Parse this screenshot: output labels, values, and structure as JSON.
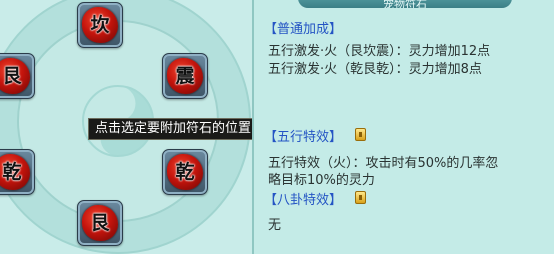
{
  "board": {
    "slots": [
      {
        "label": "坎"
      },
      {
        "label": "艮"
      },
      {
        "label": "震"
      },
      {
        "label": "乾"
      },
      {
        "label": "乾"
      },
      {
        "label": "艮"
      }
    ],
    "tooltip": "点击选定要附加符石的位置"
  },
  "panel": {
    "title": "宠物符石",
    "common_bonus": {
      "header": "【普通加成】",
      "lines": [
        "五行激发·火（艮坎震）：灵力增加12点",
        "五行激发·火（乾艮乾）：灵力增加8点"
      ]
    },
    "wuxing_effect": {
      "header": "【五行特效】",
      "line1": "五行特效（火）：攻击时有50%的几率忽",
      "line2": "略目标10%的灵力"
    },
    "bagua_effect": {
      "header": "【八卦特效】",
      "value": "无"
    }
  },
  "colors": {
    "background": "#c6ebe8",
    "section_header": "#2454c4",
    "stone_red": "#c4140c",
    "tooltip_bg": "#1a1a18"
  }
}
